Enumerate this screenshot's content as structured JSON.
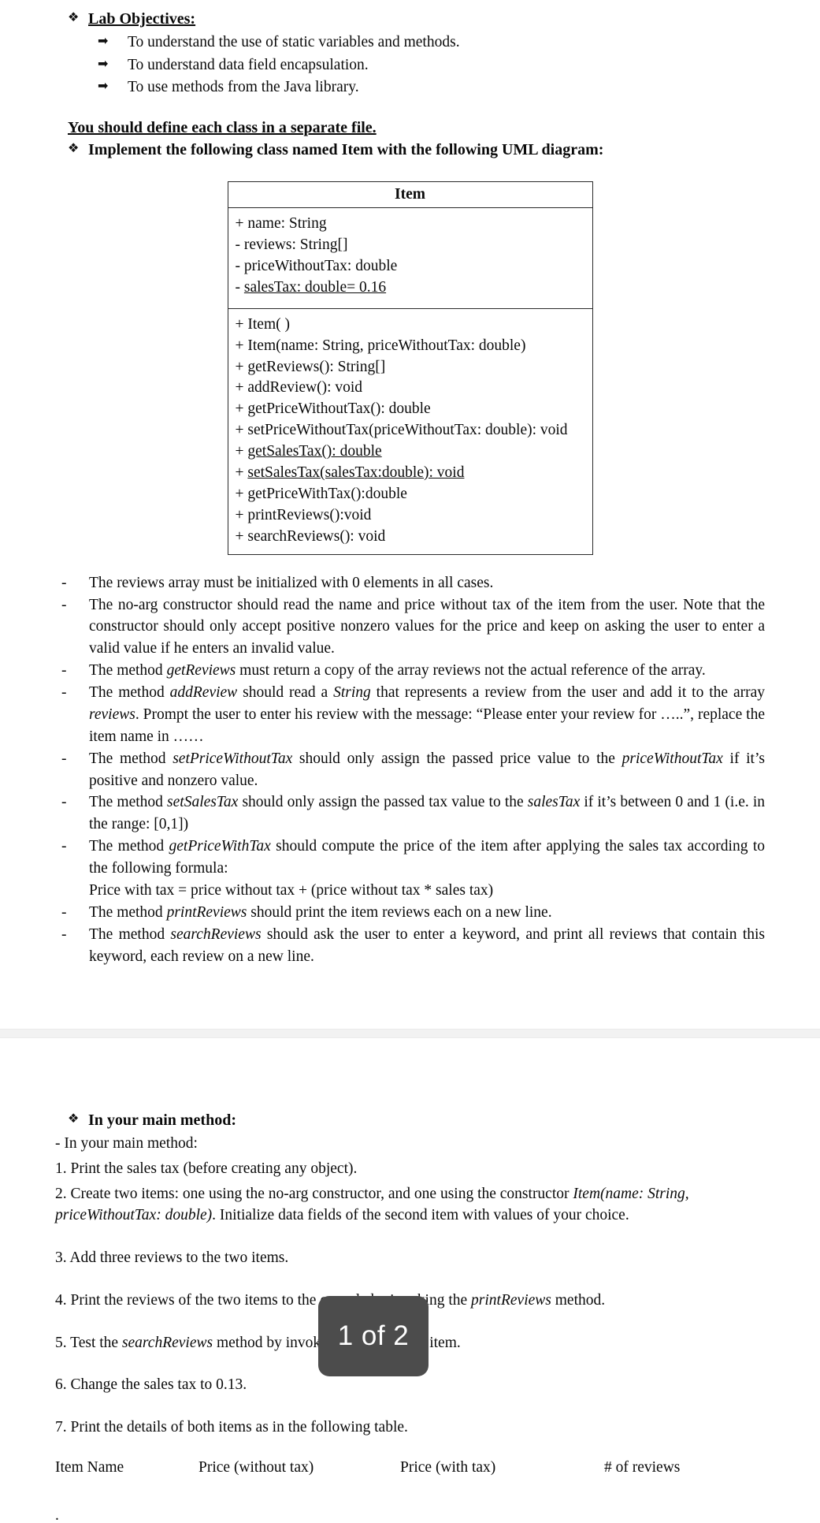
{
  "objectives": {
    "bullet_icon": "diamond-bullet-icon",
    "heading": "Lab Objectives:",
    "arrow_icon": "arrow-bullet-icon",
    "items": [
      "To understand the use of static variables and methods.",
      "To understand data field encapsulation.",
      "To use methods from the Java library."
    ]
  },
  "separate_file_notice": "You should define each class in a separate file.",
  "implement_heading": "Implement the following class named Item with the following UML diagram:",
  "uml": {
    "class_name": "Item",
    "attributes": [
      {
        "text": "+ name: String",
        "static": false
      },
      {
        "text": "- reviews: String[]",
        "static": false
      },
      {
        "text": "- priceWithoutTax: double",
        "static": false
      },
      {
        "text": "- salesTax: double= 0.16",
        "static": true
      }
    ],
    "methods": [
      {
        "text": "+ Item( )",
        "static": false
      },
      {
        "text": "+ Item(name: String, priceWithoutTax: double)",
        "static": false
      },
      {
        "text": "+ getReviews(): String[]",
        "static": false
      },
      {
        "text": "+ addReview(): void",
        "static": false
      },
      {
        "text": "+ getPriceWithoutTax(): double",
        "static": false
      },
      {
        "text": "+ setPriceWithoutTax(priceWithoutTax: double): void",
        "static": false
      },
      {
        "text": "+ getSalesTax(): double",
        "static": true
      },
      {
        "text": "+ setSalesTax(salesTax:double): void",
        "static": true
      },
      {
        "text": "+ getPriceWithTax():double",
        "static": false
      },
      {
        "text": "+ printReviews():void",
        "static": false
      },
      {
        "text": "+ searchReviews(): void",
        "static": false
      }
    ]
  },
  "requirements": {
    "dash": "-",
    "items": [
      {
        "id": "reviews-array",
        "parts": [
          {
            "t": "The reviews array must be initialized with 0 elements in all cases.",
            "i": false
          }
        ]
      },
      {
        "id": "no-arg-constructor",
        "parts": [
          {
            "t": "The no-arg constructor should read the name and price without tax of the item from the user. Note that the constructor should only accept positive nonzero values for the price and keep on asking the user to enter a valid value if he enters an invalid value.",
            "i": false
          }
        ]
      },
      {
        "id": "get-reviews",
        "parts": [
          {
            "t": "The method ",
            "i": false
          },
          {
            "t": "getReviews",
            "i": true
          },
          {
            "t": " must return a copy of the array reviews not the actual reference of the array.",
            "i": false
          }
        ]
      },
      {
        "id": "add-review",
        "parts": [
          {
            "t": "The method ",
            "i": false
          },
          {
            "t": "addReview",
            "i": true
          },
          {
            "t": " should read a ",
            "i": false
          },
          {
            "t": "String",
            "i": true
          },
          {
            "t": " that represents a review from the user and add it to the array ",
            "i": false
          },
          {
            "t": "reviews",
            "i": true
          },
          {
            "t": ". Prompt the user to enter his review with the message: “Please enter your review for …..”, replace the item name in ……",
            "i": false
          }
        ]
      },
      {
        "id": "set-price-without-tax",
        "parts": [
          {
            "t": "The method ",
            "i": false
          },
          {
            "t": "setPriceWithoutTax",
            "i": true
          },
          {
            "t": " should only assign the passed price value to the ",
            "i": false
          },
          {
            "t": "priceWithoutTax",
            "i": true
          },
          {
            "t": " if it’s positive and nonzero value.",
            "i": false
          }
        ]
      },
      {
        "id": "set-sales-tax",
        "parts": [
          {
            "t": "The method ",
            "i": false
          },
          {
            "t": "setSalesTax",
            "i": true
          },
          {
            "t": " should only assign the passed tax value to the ",
            "i": false
          },
          {
            "t": "salesTax",
            "i": true
          },
          {
            "t": " if it’s between 0 and 1 (i.e. in the range: [0,1])",
            "i": false
          }
        ]
      },
      {
        "id": "get-price-with-tax",
        "parts": [
          {
            "t": "The method ",
            "i": false
          },
          {
            "t": "getPriceWithTax",
            "i": true
          },
          {
            "t": " should compute the price of the item after applying the sales tax according to the following formula:",
            "i": false
          }
        ],
        "extra_line": "Price with tax = price without tax + (price without tax * sales tax)"
      },
      {
        "id": "print-reviews",
        "parts": [
          {
            "t": "The method ",
            "i": false
          },
          {
            "t": "printReviews",
            "i": true
          },
          {
            "t": " should print the item reviews each on a new line.",
            "i": false
          }
        ]
      },
      {
        "id": "search-reviews",
        "parts": [
          {
            "t": "The method ",
            "i": false
          },
          {
            "t": "searchReviews",
            "i": true
          },
          {
            "t": " should ask the user to enter a keyword, and print all reviews that contain this keyword, each review on a new line.",
            "i": false
          }
        ]
      }
    ]
  },
  "main_method": {
    "bullet_icon": "diamond-bullet-icon",
    "heading": "In your main method:",
    "intro": "- In your main method:",
    "steps": [
      {
        "id": "step-1",
        "parts": [
          {
            "t": "1. Print the sales tax (before creating any object).",
            "i": false
          }
        ]
      },
      {
        "id": "step-2",
        "parts": [
          {
            "t": "2. Create two items: one using the no-arg constructor, and one using the constructor ",
            "i": false
          },
          {
            "t": "Item(name: String, priceWithoutTax: double)",
            "i": true
          },
          {
            "t": ". Initialize data fields of the second item with values of your choice.",
            "i": false
          }
        ]
      },
      {
        "id": "step-3",
        "parts": [
          {
            "t": "3. Add three reviews to the two items.",
            "i": false
          }
        ]
      },
      {
        "id": "step-4",
        "parts": [
          {
            "t": "4. Print the reviews of the two items to the console by invoking the ",
            "i": false
          },
          {
            "t": "printReviews",
            "i": true
          },
          {
            "t": " method.",
            "i": false
          }
        ]
      },
      {
        "id": "step-5",
        "parts": [
          {
            "t": "5. Test the ",
            "i": false
          },
          {
            "t": "searchReviews",
            "i": true
          },
          {
            "t": " method by invoking it for the first item.",
            "i": false
          }
        ]
      },
      {
        "id": "step-6",
        "parts": [
          {
            "t": "6. Change the sales tax to 0.13.",
            "i": false
          }
        ]
      },
      {
        "id": "step-7",
        "parts": [
          {
            "t": "7. Print the details of both items as in the following table.",
            "i": false
          }
        ]
      }
    ]
  },
  "result_table": {
    "headers": [
      "Item Name",
      "Price (without tax)",
      "Price (with tax)",
      "# of reviews"
    ]
  },
  "trailing_dot": ".",
  "page_indicator": {
    "label": "1 of 2",
    "background": "#4c4c4c",
    "text_color": "#ffffff"
  }
}
